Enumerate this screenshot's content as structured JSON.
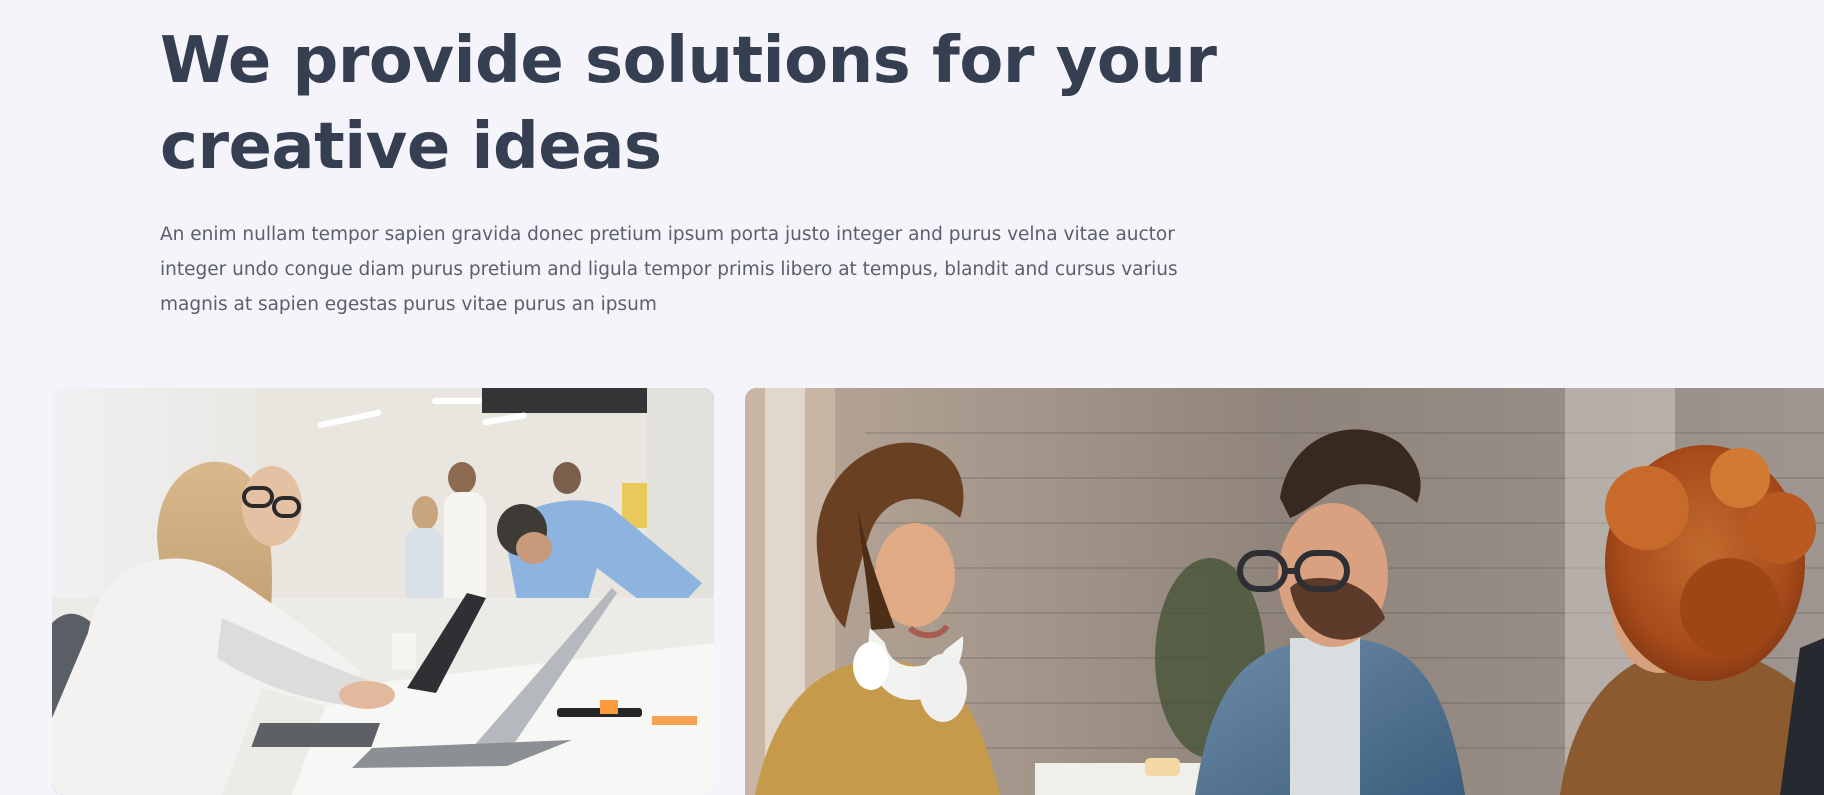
{
  "hero": {
    "heading_lines": [
      "We provide solutions for your",
      "creative ideas"
    ],
    "description_lines": [
      "An enim nullam tempor sapien gravida donec pretium ipsum porta justo integer and purus velna vitae auctor",
      "integer undo congue diam purus pretium and ligula tempor primis libero at tempus, blandit and cursus varius",
      "magnis at sapien egestas purus vitae purus an ipsum"
    ]
  },
  "gallery": {
    "images": [
      {
        "icon": "office-laptop-photo"
      },
      {
        "icon": "team-meeting-photo"
      }
    ]
  },
  "colors": {
    "background": "#f4f4fa",
    "heading": "#353f51",
    "body_text": "#5b5f6b"
  }
}
